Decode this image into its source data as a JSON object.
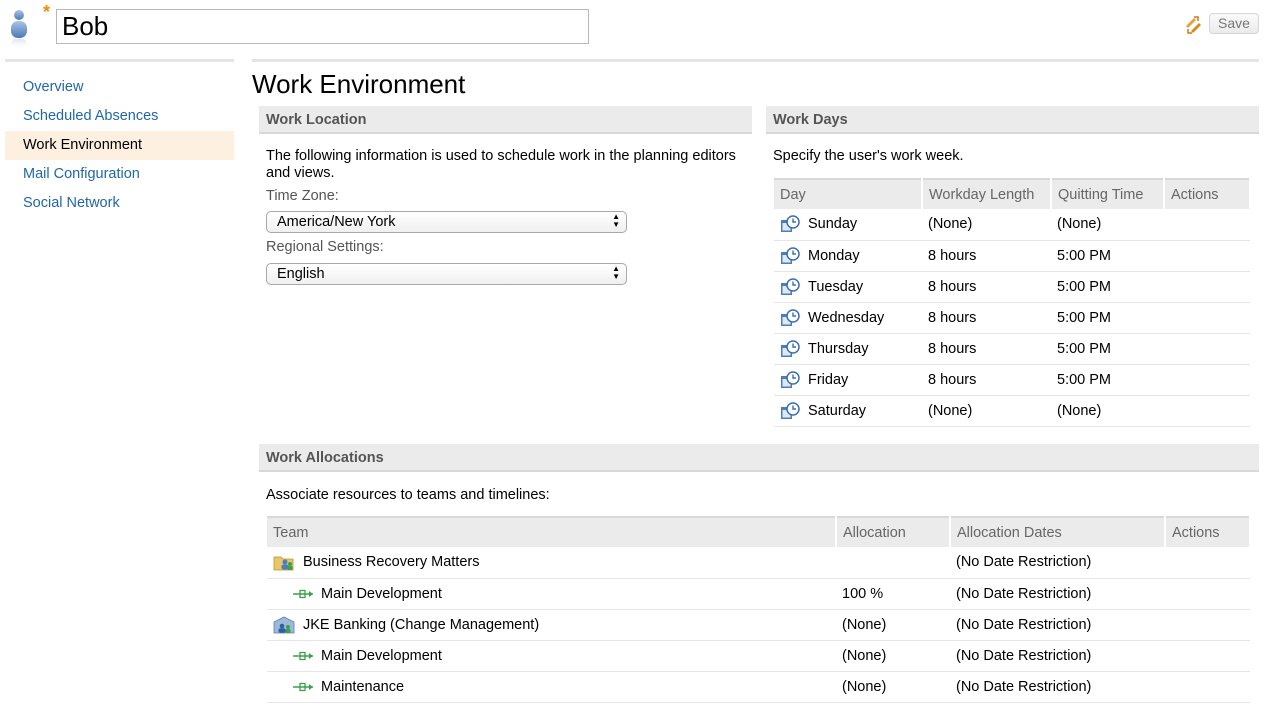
{
  "header": {
    "name_value": "Bob",
    "dirty_marker": "*",
    "save_label": "Save"
  },
  "sidebar": {
    "items": [
      {
        "label": "Overview",
        "active": false
      },
      {
        "label": "Scheduled Absences",
        "active": false
      },
      {
        "label": "Work Environment",
        "active": true
      },
      {
        "label": "Mail Configuration",
        "active": false
      },
      {
        "label": "Social Network",
        "active": false
      }
    ]
  },
  "main": {
    "title": "Work Environment",
    "work_location": {
      "heading": "Work Location",
      "description": "The following information is used to schedule work in the planning editors and views.",
      "time_zone_label": "Time Zone:",
      "time_zone_value": "America/New York",
      "regional_label": "Regional Settings:",
      "regional_value": "English"
    },
    "work_days": {
      "heading": "Work Days",
      "description": "Specify the user's work week.",
      "columns": [
        "Day",
        "Workday Length",
        "Quitting Time",
        "Actions"
      ],
      "rows": [
        {
          "day": "Sunday",
          "length": "(None)",
          "quit": "(None)"
        },
        {
          "day": "Monday",
          "length": "8 hours",
          "quit": "5:00 PM"
        },
        {
          "day": "Tuesday",
          "length": "8 hours",
          "quit": "5:00 PM"
        },
        {
          "day": "Wednesday",
          "length": "8 hours",
          "quit": "5:00 PM"
        },
        {
          "day": "Thursday",
          "length": "8 hours",
          "quit": "5:00 PM"
        },
        {
          "day": "Friday",
          "length": "8 hours",
          "quit": "5:00 PM"
        },
        {
          "day": "Saturday",
          "length": "(None)",
          "quit": "(None)"
        }
      ]
    },
    "work_allocations": {
      "heading": "Work Allocations",
      "description": "Associate resources to teams and timelines:",
      "columns": [
        "Team",
        "Allocation",
        "Allocation Dates",
        "Actions"
      ],
      "rows": [
        {
          "team": "Business Recovery Matters",
          "allocation": "",
          "dates": "(No Date Restriction)",
          "kind": "team-area"
        },
        {
          "team": "Main Development",
          "allocation": "100 %",
          "dates": "(No Date Restriction)",
          "kind": "timeline"
        },
        {
          "team": "JKE Banking (Change Management)",
          "allocation": "(None)",
          "dates": "(No Date Restriction)",
          "kind": "project-area"
        },
        {
          "team": "Main Development",
          "allocation": "(None)",
          "dates": "(No Date Restriction)",
          "kind": "timeline"
        },
        {
          "team": "Maintenance",
          "allocation": "(None)",
          "dates": "(No Date Restriction)",
          "kind": "timeline"
        }
      ]
    }
  },
  "colors": {
    "link": "#1f67a8",
    "active_nav_bg": "#fdf0e0",
    "section_header_bg": "#ebebeb",
    "dirty_marker": "#f08c00"
  }
}
